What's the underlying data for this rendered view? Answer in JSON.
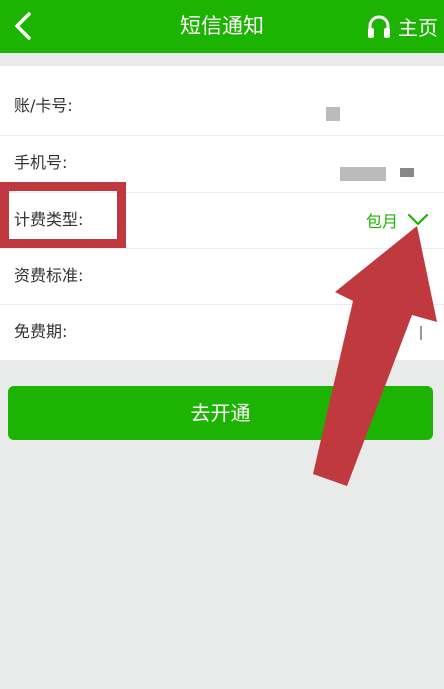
{
  "header": {
    "title": "短信通知",
    "home_label": "主页"
  },
  "form": {
    "rows": [
      {
        "label": "账/卡号:"
      },
      {
        "label": "手机号:"
      },
      {
        "label": "计费类型:",
        "value": "包月"
      },
      {
        "label": "资费标准:"
      },
      {
        "label": "免费期:"
      }
    ]
  },
  "actions": {
    "open_label": "去开通"
  },
  "colors": {
    "brand_green": "#1db303",
    "annotation_red": "#c0393e",
    "background": "#e9ebea"
  },
  "icons": [
    "back-chevron-icon",
    "headset-icon",
    "chevron-down-icon"
  ]
}
